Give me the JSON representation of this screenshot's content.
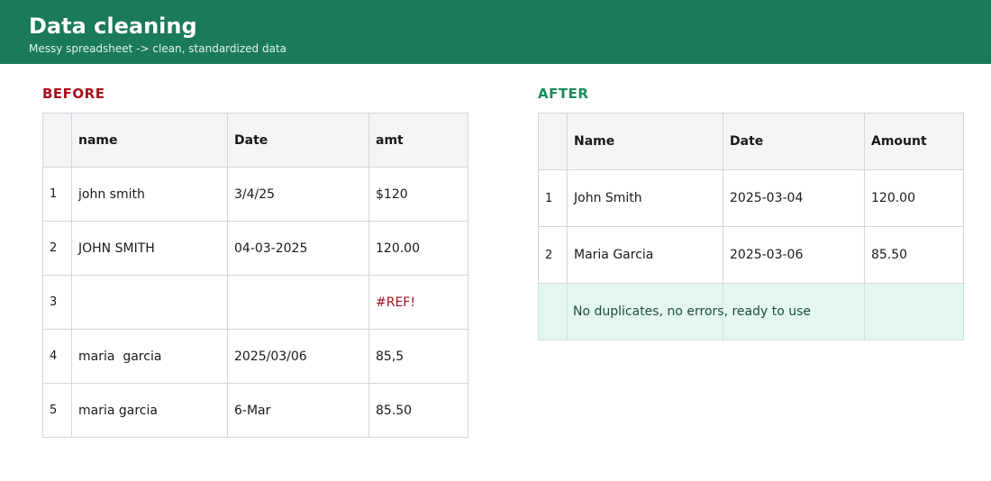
{
  "header": {
    "title": "Data cleaning",
    "subtitle": "Messy spreadsheet -> clean, standardized data"
  },
  "before": {
    "label": "BEFORE",
    "columns": [
      "",
      "name",
      "Date",
      "amt"
    ],
    "rows": [
      {
        "num": "1",
        "name": "john smith",
        "date": "3/4/25",
        "amt": "$120"
      },
      {
        "num": "2",
        "name": "JOHN SMITH",
        "date": "04-03-2025",
        "amt": "120.00"
      },
      {
        "num": "3",
        "name": "",
        "date": "",
        "amt": "#REF!"
      },
      {
        "num": "4",
        "name": "maria  garcia",
        "date": "2025/03/06",
        "amt": "85,5"
      },
      {
        "num": "5",
        "name": "maria garcia",
        "date": "6-Mar",
        "amt": "85.50"
      }
    ]
  },
  "after": {
    "label": "AFTER",
    "columns": [
      "",
      "Name",
      "Date",
      "Amount"
    ],
    "rows": [
      {
        "num": "1",
        "name": "John Smith",
        "date": "2025-03-04",
        "amt": "120.00"
      },
      {
        "num": "2",
        "name": "Maria Garcia",
        "date": "2025-03-06",
        "amt": "85.50"
      }
    ],
    "summary": "No duplicates, no errors, ready to use"
  },
  "colors": {
    "header_bg": "#1a7a5a",
    "before_accent": "#a6101c",
    "after_accent": "#1a8a5a",
    "summary_bg": "#e4f6f0"
  }
}
